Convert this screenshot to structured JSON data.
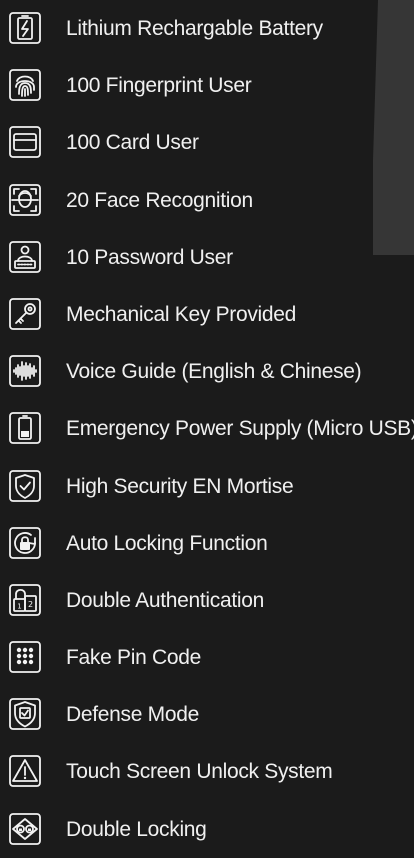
{
  "features": [
    {
      "icon": "battery-bolt-icon",
      "label": "Lithium Rechargable Battery"
    },
    {
      "icon": "fingerprint-icon",
      "label": "100 Fingerprint User"
    },
    {
      "icon": "card-icon",
      "label": "100 Card User"
    },
    {
      "icon": "face-recognition-icon",
      "label": "20 Face Recognition"
    },
    {
      "icon": "password-user-icon",
      "label": "10 Password User"
    },
    {
      "icon": "key-icon",
      "label": "Mechanical Key Provided"
    },
    {
      "icon": "voice-waveform-icon",
      "label": "Voice Guide (English & Chinese)"
    },
    {
      "icon": "battery-icon",
      "label": "Emergency Power Supply (Micro USB)"
    },
    {
      "icon": "shield-check-icon",
      "label": "High Security EN Mortise"
    },
    {
      "icon": "auto-lock-icon",
      "label": "Auto Locking Function"
    },
    {
      "icon": "double-lock-auth-icon",
      "label": "Double Authentication"
    },
    {
      "icon": "keypad-dots-icon",
      "label": "Fake Pin Code"
    },
    {
      "icon": "defense-shield-icon",
      "label": "Defense Mode"
    },
    {
      "icon": "warning-triangle-icon",
      "label": "Touch Screen Unlock System"
    },
    {
      "icon": "double-locking-icon",
      "label": "Double Locking"
    }
  ],
  "colors": {
    "background": "#1b1b1b",
    "panel": "#363636",
    "text": "#f0f0f0"
  }
}
